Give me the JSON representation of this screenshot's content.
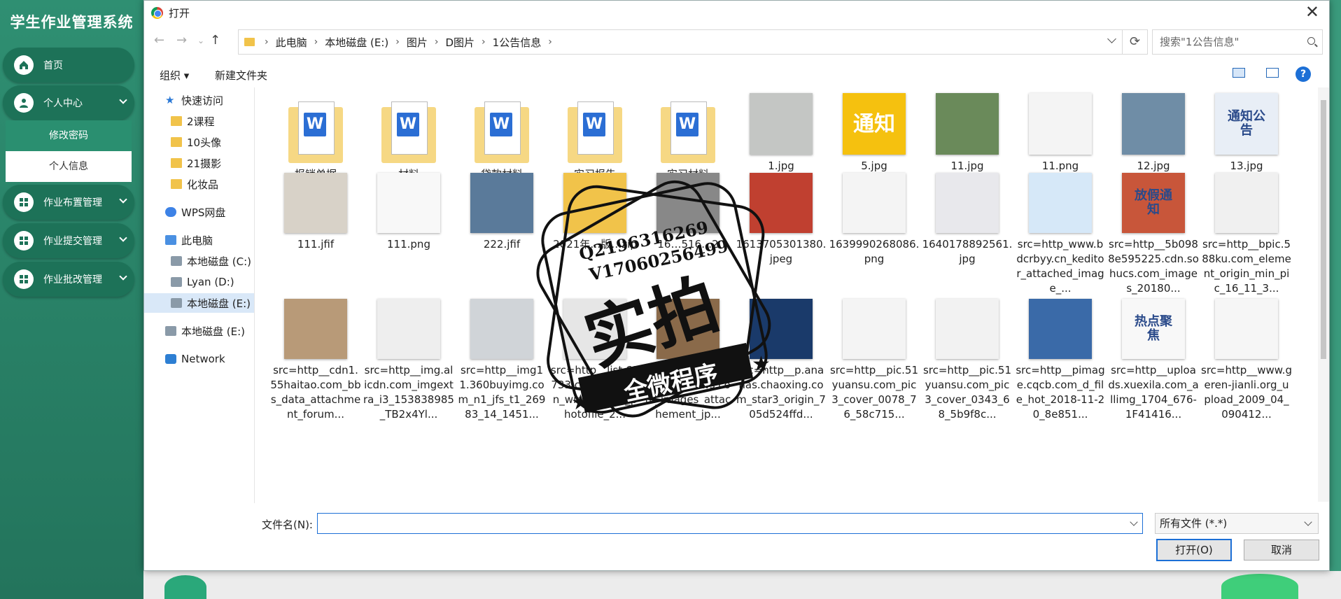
{
  "app": {
    "title": "学生作业管理系统",
    "nav": [
      {
        "label": "首页",
        "icon": "home-icon"
      },
      {
        "label": "个人中心",
        "icon": "user-icon"
      },
      {
        "label": "作业布置管理",
        "icon": "grid-icon"
      },
      {
        "label": "作业提交管理",
        "icon": "grid-icon"
      },
      {
        "label": "作业批改管理",
        "icon": "grid-icon"
      }
    ],
    "sub": [
      "修改密码",
      "个人信息"
    ]
  },
  "dialog": {
    "title": "打开",
    "breadcrumb": [
      "此电脑",
      "本地磁盘 (E:)",
      "图片",
      "D图片",
      "1公告信息"
    ],
    "search_placeholder": "搜索\"1公告信息\"",
    "organize": "组织 ▾",
    "new_folder": "新建文件夹",
    "help": "?",
    "tree": [
      {
        "label": "快速访问",
        "icon": "star-icon"
      },
      {
        "label": "2课程",
        "icon": "folder-icon"
      },
      {
        "label": "10头像",
        "icon": "folder-icon"
      },
      {
        "label": "21摄影",
        "icon": "folder-icon"
      },
      {
        "label": "化妆品",
        "icon": "folder-icon"
      },
      {
        "label": "WPS网盘",
        "icon": "cloud-icon"
      },
      {
        "label": "此电脑",
        "icon": "computer-icon"
      },
      {
        "label": "本地磁盘 (C:)",
        "icon": "drive-icon"
      },
      {
        "label": "Lyan (D:)",
        "icon": "drive-icon"
      },
      {
        "label": "本地磁盘 (E:)",
        "icon": "drive-icon"
      },
      {
        "label": "本地磁盘 (E:)",
        "icon": "drive-icon"
      },
      {
        "label": "Network",
        "icon": "network-icon"
      }
    ],
    "files": [
      {
        "name": "报销单据",
        "kind": "folder"
      },
      {
        "name": "材料",
        "kind": "folder"
      },
      {
        "name": "贷款材料",
        "kind": "folder"
      },
      {
        "name": "实习报告",
        "kind": "folder"
      },
      {
        "name": "实习材料",
        "kind": "folder"
      },
      {
        "name": "1.jpg",
        "kind": "image",
        "color": "#c4c6c4"
      },
      {
        "name": "5.jpg",
        "kind": "image",
        "color": "#f5c10f",
        "overlay": "通知"
      },
      {
        "name": "11.jpg",
        "kind": "image",
        "color": "#6a8a5a"
      },
      {
        "name": "11.png",
        "kind": "image",
        "color": "#f4f4f4"
      },
      {
        "name": "12.jpg",
        "kind": "image",
        "color": "#6f8da6"
      },
      {
        "name": "13.jpg",
        "kind": "image",
        "color": "#e8eef6",
        "overlay": "通知公告"
      },
      {
        "name": "111.jfif",
        "kind": "image",
        "color": "#d8d2c8"
      },
      {
        "name": "111.png",
        "kind": "image",
        "color": "#f8f8f8"
      },
      {
        "name": "222.jfif",
        "kind": "image",
        "color": "#5a7a9a"
      },
      {
        "name": "2021年…版…zip",
        "kind": "image",
        "color": "#f1c34a"
      },
      {
        "name": "16…516…2",
        "kind": "image",
        "color": "#888"
      },
      {
        "name": "1613705301380.jpeg",
        "kind": "image",
        "color": "#c04030"
      },
      {
        "name": "1639990268086.png",
        "kind": "image",
        "color": "#f4f4f4"
      },
      {
        "name": "1640178892561.jpg",
        "kind": "image",
        "color": "#e8e8ec"
      },
      {
        "name": "src=http_www.bdcrbyy.cn_keditor_attached_image_...",
        "kind": "image",
        "color": "#d6e8f8"
      },
      {
        "name": "src=http__5b0988e595225.cdn.sohucs.com_images_20180...",
        "kind": "image",
        "color": "#c8563a",
        "overlay": "放假通知"
      },
      {
        "name": "src=http__bpic.588ku.com_element_origin_min_pic_16_11_3...",
        "kind": "image",
        "color": "#f0f0f0"
      },
      {
        "name": "src=http__cdn1.55haitao.com_bbs_data_attachment_forum...",
        "kind": "image",
        "color": "#b89a78"
      },
      {
        "name": "src=http__img.alicdn.com_imgextra_i3_153838985_TB2x4Yl...",
        "kind": "image",
        "color": "#eeeeee"
      },
      {
        "name": "src=http__img11.360buyimg.com_n1_jfs_t1_26983_14_1451...",
        "kind": "image",
        "color": "#d0d4d8"
      },
      {
        "name": "src=http__list.63733.com_z_plugin_windsphoto_photofile_2...",
        "kind": "image",
        "color": "#e6e6e6"
      },
      {
        "name": "src=http__news.qingdaonews.com_images_attachement_jp...",
        "kind": "image",
        "color": "#8a6a4a"
      },
      {
        "name": "src=http__p.ananas.chaoxing.com_star3_origin_705d524ffd...",
        "kind": "image",
        "color": "#1a3a6a"
      },
      {
        "name": "src=http__pic.51yuansu.com_pic3_cover_0078_76_58c715...",
        "kind": "image",
        "color": "#f4f4f4"
      },
      {
        "name": "src=http__pic.51yuansu.com_pic3_cover_0343_68_5b9f8c...",
        "kind": "image",
        "color": "#f2f2f2"
      },
      {
        "name": "src=http__pimage.cqcb.com_d_file_hot_2018-11-20_8e851...",
        "kind": "image",
        "color": "#3a6aa8"
      },
      {
        "name": "src=http__uploads.xuexila.com_allimg_1704_676-1F41416...",
        "kind": "image",
        "color": "#f8f8f8",
        "overlay": "热点聚焦"
      },
      {
        "name": "src=http__www.geren-jianli.org_upload_2009_04_090412...",
        "kind": "image",
        "color": "#f6f6f6"
      }
    ],
    "filename_label": "文件名(N):",
    "filename_value": "",
    "filetype": "所有文件 (*.*)",
    "open_label": "打开(O)",
    "cancel_label": "取消"
  },
  "stamp": {
    "line1": "Q2196316269",
    "line2": "V17060256499",
    "main": "实拍",
    "banner": "全微程序"
  }
}
